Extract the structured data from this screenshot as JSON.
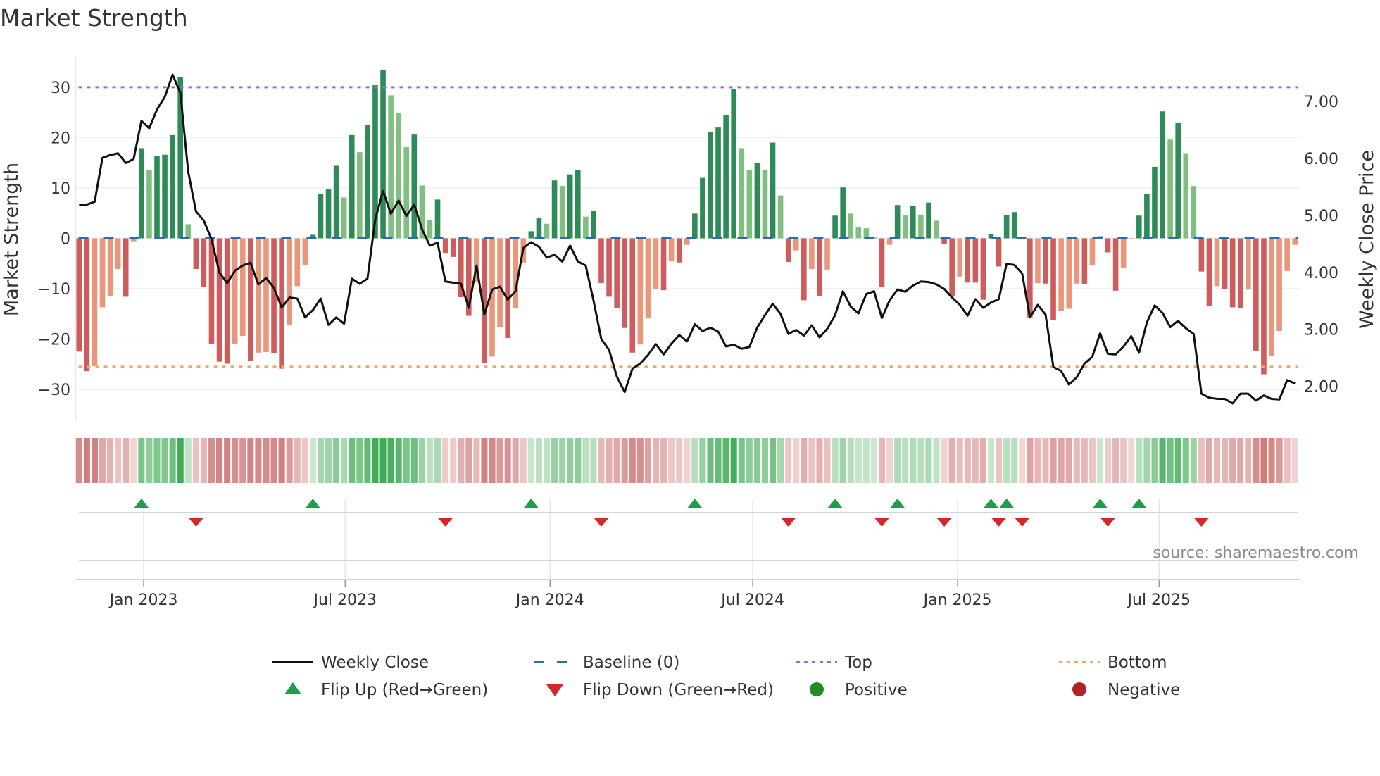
{
  "title": "Market Strength",
  "source": "source: sharemaestro.com",
  "colors": {
    "pos_up": "#2e8b57",
    "pos_down": "#80bf80",
    "neg_down": "#cd5c5c",
    "neg_up": "#e9967a",
    "line": "#111111",
    "baseline": "#2b6ea3",
    "top": "#9b6bd8",
    "bottom": "#f0a868",
    "flip_up": "#1f9e4a",
    "flip_down": "#d62728",
    "positive": "#228b22",
    "negative": "#b22222",
    "grid": "#eceff3"
  },
  "legend": [
    {
      "label": "Weekly Close",
      "kind": "line"
    },
    {
      "label": "Baseline (0)",
      "kind": "dash"
    },
    {
      "label": "Top",
      "kind": "dot-top"
    },
    {
      "label": "Bottom",
      "kind": "dot-bottom"
    },
    {
      "label": "Flip Up (Red→Green)",
      "kind": "tri-up"
    },
    {
      "label": "Flip Down (Green→Red)",
      "kind": "tri-down"
    },
    {
      "label": "Positive",
      "kind": "circle-pos"
    },
    {
      "label": "Negative",
      "kind": "circle-neg"
    }
  ],
  "chart_data": {
    "type": "bar",
    "title": "Market Strength",
    "frequency": "weekly",
    "start_date": "2022-11-04",
    "ylabel": "Market Strength",
    "y2label": "Weekly Close Price",
    "ylim": [
      -36.3,
      36.0
    ],
    "y2lim": [
      1.39,
      7.78
    ],
    "yticks": [
      30,
      20,
      10,
      0,
      -10,
      -20,
      -30
    ],
    "ytick_labels": [
      "30",
      "20",
      "10",
      "0",
      "−10",
      "−20",
      "−30"
    ],
    "y2ticks": [
      7,
      6,
      5,
      4,
      3,
      2
    ],
    "y2tick_labels": [
      "7.00",
      "6.00",
      "5.00",
      "4.00",
      "3.00",
      "2.00"
    ],
    "xticks": [
      {
        "label": "Jan 2023",
        "date": "2023-01-01"
      },
      {
        "label": "Jul 2023",
        "date": "2023-07-01"
      },
      {
        "label": "Jan 2024",
        "date": "2024-01-01"
      },
      {
        "label": "Jul 2024",
        "date": "2024-07-01"
      },
      {
        "label": "Jan 2025",
        "date": "2025-01-01"
      },
      {
        "label": "Jul 2025",
        "date": "2025-07-01"
      }
    ],
    "top_level": 30,
    "bottom_level": -25.5,
    "baseline": 0,
    "grid": true,
    "legend_position": "bottom",
    "series": [
      {
        "name": "Market Strength",
        "type": "bar",
        "values": [
          -22.5,
          -26.4,
          -25.4,
          -13.7,
          -11.4,
          -6.1,
          -11.6,
          -0.6,
          17.9,
          13.6,
          16.4,
          16.6,
          20.5,
          32.0,
          2.8,
          -6.1,
          -9.7,
          -21.0,
          -24.5,
          -24.9,
          -21.0,
          -19.4,
          -24.3,
          -22.7,
          -22.6,
          -22.8,
          -25.9,
          -17.3,
          -9.5,
          -5.3,
          0.7,
          8.8,
          9.7,
          14.4,
          8.1,
          20.5,
          17.1,
          22.5,
          30.4,
          33.5,
          28.4,
          24.9,
          18.1,
          20.6,
          10.5,
          3.6,
          7.7,
          -2.9,
          -3.7,
          -11.7,
          -15.4,
          -8.6,
          -24.8,
          -23.5,
          -17.7,
          -19.8,
          -13.9,
          -4.8,
          1.4,
          4.1,
          2.9,
          11.5,
          10.4,
          12.7,
          13.5,
          4.3,
          5.4,
          -8.9,
          -11.6,
          -13.8,
          -17.8,
          -22.7,
          -21.1,
          -15.9,
          -10.1,
          -10.3,
          -4.5,
          -4.8,
          -1.3,
          4.9,
          12.0,
          21.1,
          22.0,
          24.5,
          29.6,
          17.9,
          13.6,
          15.0,
          13.6,
          19.0,
          8.5,
          -4.7,
          -2.4,
          -12.3,
          -6.1,
          -11.4,
          -6.2,
          4.5,
          10.1,
          4.9,
          2.2,
          2.0,
          0.3,
          -9.6,
          -1.3,
          6.6,
          4.6,
          6.5,
          4.7,
          7.1,
          3.5,
          -1.2,
          -11.5,
          -7.6,
          -8.8,
          -8.8,
          -12.2,
          0.8,
          -5.6,
          4.6,
          5.2,
          -0.2,
          -15.7,
          -8.9,
          -9.0,
          -16.2,
          -14.4,
          -14.0,
          -9.0,
          -9.1,
          -5.3,
          0.4,
          -2.8,
          -10.4,
          -5.8,
          -0.2,
          4.5,
          8.8,
          14.2,
          25.2,
          19.6,
          23.0,
          16.9,
          10.4,
          -6.6,
          -13.5,
          -9.5,
          -10.1,
          -13.7,
          -13.9,
          -10.2,
          -22.3,
          -27.0,
          -23.4,
          -18.4,
          -6.5,
          -1.3
        ]
      },
      {
        "name": "Weekly Close",
        "type": "line",
        "axis": "right",
        "values": [
          5.19,
          5.19,
          5.24,
          6.01,
          6.06,
          6.09,
          5.92,
          5.99,
          6.66,
          6.53,
          6.86,
          7.08,
          7.47,
          7.15,
          5.77,
          5.07,
          4.91,
          4.58,
          4.0,
          3.81,
          4.03,
          4.12,
          4.17,
          3.79,
          3.9,
          3.73,
          3.38,
          3.56,
          3.54,
          3.21,
          3.34,
          3.54,
          3.08,
          3.21,
          3.1,
          3.89,
          3.8,
          3.89,
          4.93,
          5.43,
          5.03,
          5.26,
          4.99,
          5.19,
          4.76,
          4.47,
          4.52,
          3.84,
          3.82,
          3.8,
          3.38,
          4.12,
          3.26,
          3.7,
          3.75,
          3.52,
          3.67,
          4.43,
          4.53,
          4.45,
          4.26,
          4.31,
          4.19,
          4.47,
          4.19,
          4.12,
          3.51,
          2.83,
          2.64,
          2.17,
          1.9,
          2.31,
          2.4,
          2.55,
          2.74,
          2.56,
          2.75,
          2.9,
          2.79,
          3.09,
          2.97,
          3.03,
          2.96,
          2.7,
          2.73,
          2.66,
          2.69,
          3.03,
          3.25,
          3.45,
          3.27,
          2.92,
          2.99,
          2.89,
          3.07,
          2.86,
          3.01,
          3.25,
          3.67,
          3.4,
          3.28,
          3.62,
          3.67,
          3.2,
          3.51,
          3.7,
          3.66,
          3.77,
          3.84,
          3.83,
          3.79,
          3.71,
          3.56,
          3.43,
          3.24,
          3.53,
          3.38,
          3.47,
          3.53,
          4.15,
          4.13,
          3.98,
          3.21,
          3.43,
          3.26,
          2.34,
          2.27,
          2.03,
          2.16,
          2.4,
          2.52,
          2.93,
          2.57,
          2.56,
          2.7,
          2.88,
          2.59,
          3.12,
          3.42,
          3.29,
          3.04,
          3.15,
          3.02,
          2.92,
          1.87,
          1.8,
          1.78,
          1.78,
          1.7,
          1.87,
          1.87,
          1.75,
          1.84,
          1.78,
          1.77,
          2.11,
          2.05
        ]
      }
    ],
    "flips_up_week_index": [
      9,
      31,
      59,
      80,
      98,
      106,
      118,
      120,
      132,
      137
    ],
    "flips_down_week_index": [
      16,
      48,
      68,
      92,
      104,
      112,
      119,
      122,
      133,
      145
    ]
  }
}
